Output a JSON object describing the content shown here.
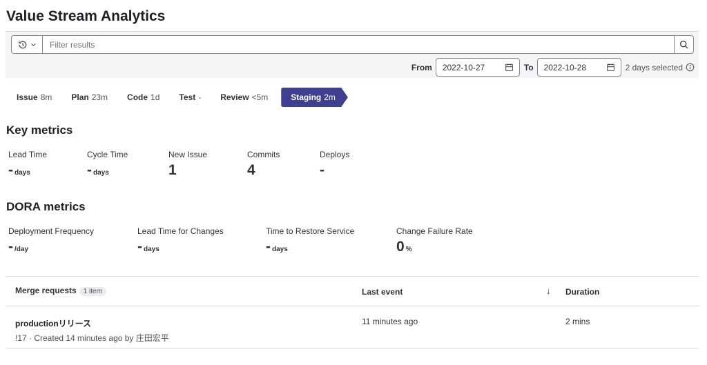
{
  "page": {
    "title": "Value Stream Analytics"
  },
  "filter": {
    "placeholder": "Filter results"
  },
  "date_range": {
    "from_label": "From",
    "from_value": "2022-10-27",
    "to_label": "To",
    "to_value": "2022-10-28",
    "days_selected": "2 days selected"
  },
  "stages": [
    {
      "name": "Issue",
      "time": "8m"
    },
    {
      "name": "Plan",
      "time": "23m"
    },
    {
      "name": "Code",
      "time": "1d"
    },
    {
      "name": "Test",
      "time": "-"
    },
    {
      "name": "Review",
      "time": "<5m"
    },
    {
      "name": "Staging",
      "time": "2m",
      "active": true
    }
  ],
  "key_metrics": {
    "title": "Key metrics",
    "items": [
      {
        "label": "Lead Time",
        "value": "-",
        "unit": "days"
      },
      {
        "label": "Cycle Time",
        "value": "-",
        "unit": "days"
      },
      {
        "label": "New Issue",
        "value": "1",
        "unit": ""
      },
      {
        "label": "Commits",
        "value": "4",
        "unit": ""
      },
      {
        "label": "Deploys",
        "value": "-",
        "unit": ""
      }
    ]
  },
  "dora_metrics": {
    "title": "DORA metrics",
    "items": [
      {
        "label": "Deployment Frequency",
        "value": "-",
        "unit": "/day"
      },
      {
        "label": "Lead Time for Changes",
        "value": "-",
        "unit": "days"
      },
      {
        "label": "Time to Restore Service",
        "value": "-",
        "unit": "days"
      },
      {
        "label": "Change Failure Rate",
        "value": "0",
        "unit": "%"
      }
    ]
  },
  "table": {
    "headers": {
      "merge_requests": "Merge requests",
      "count_badge": "1 item",
      "last_event": "Last event",
      "sort_arrow": "↓",
      "duration": "Duration"
    },
    "rows": [
      {
        "title": "productionリリース",
        "meta": "!17 · Created 14 minutes ago by 庄田宏平",
        "last_event": "11 minutes ago",
        "duration": "2 mins"
      }
    ]
  },
  "icons": {
    "history": "history-icon",
    "chevron": "chevron-down-icon",
    "search": "search-icon",
    "calendar": "calendar-icon",
    "info": "info-icon"
  },
  "colors": {
    "active_stage": "#3f3f91"
  }
}
